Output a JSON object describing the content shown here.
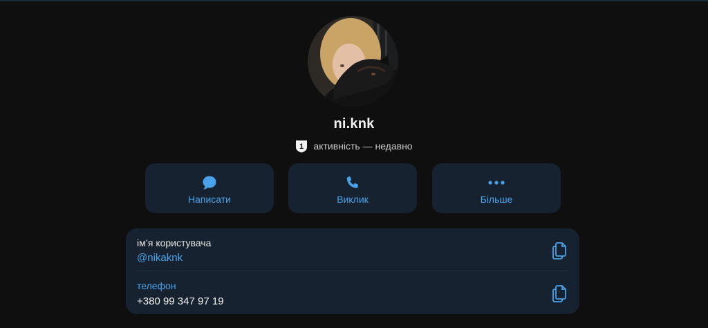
{
  "profile": {
    "display_name": "ni.knk",
    "status_badge": "1",
    "status_text": "активність — недавно"
  },
  "actions": [
    {
      "label": "Написати",
      "icon": "chat-bubble-icon"
    },
    {
      "label": "Виклик",
      "icon": "phone-icon"
    },
    {
      "label": "Більше",
      "icon": "more-dots-icon"
    }
  ],
  "info": {
    "username": {
      "caption": "ім’я користувача",
      "value": "@nikaknk"
    },
    "phone": {
      "caption": "телефон",
      "value": "+380 99 347 97 19"
    }
  },
  "colors": {
    "background": "#0f0f0f",
    "card": "#172230",
    "accent": "#4aa3ea",
    "primary_text": "#f2f2f2"
  }
}
